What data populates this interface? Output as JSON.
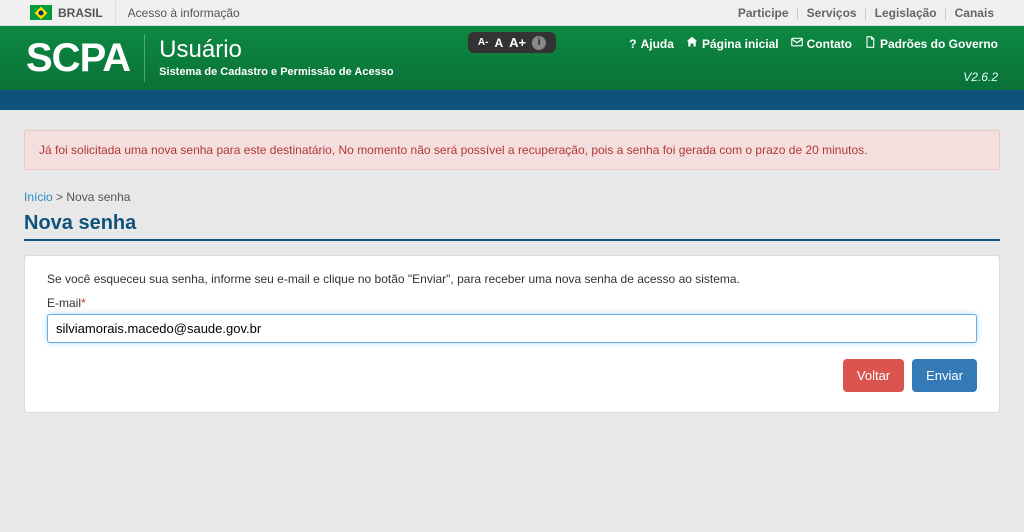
{
  "topbar": {
    "brasil": "BRASIL",
    "acesso": "Acesso à informação",
    "links": {
      "participe": "Participe",
      "servicos": "Serviços",
      "legislacao": "Legislação",
      "canais": "Canais"
    }
  },
  "header": {
    "logo": "SCPA",
    "title": "Usuário",
    "subtitle": "Sistema de Cadastro e Permissão de Acesso",
    "fontsize": {
      "small": "A-",
      "mid": "A",
      "large": "A+",
      "info": "i"
    },
    "links": {
      "ajuda": "Ajuda",
      "pagina_inicial": "Página inicial",
      "contato": "Contato",
      "padroes": "Padrões do Governo"
    },
    "version": "V2.6.2"
  },
  "alert": {
    "message": "Já foi solicitada uma nova senha para este destinatário, No momento não será possível a recuperação, pois a senha foi gerada com o prazo de 20 minutos."
  },
  "breadcrumb": {
    "home": "Início",
    "separator": ">",
    "current": "Nova senha"
  },
  "page": {
    "title": "Nova senha",
    "instructions": "Se você esqueceu sua senha, informe seu e-mail e clique no botão \"Enviar\", para receber uma nova senha de acesso ao sistema.",
    "email_label": "E-mail",
    "required_mark": "*",
    "email_value": "silviamorais.macedo@saude.gov.br",
    "buttons": {
      "voltar": "Voltar",
      "enviar": "Enviar"
    }
  }
}
